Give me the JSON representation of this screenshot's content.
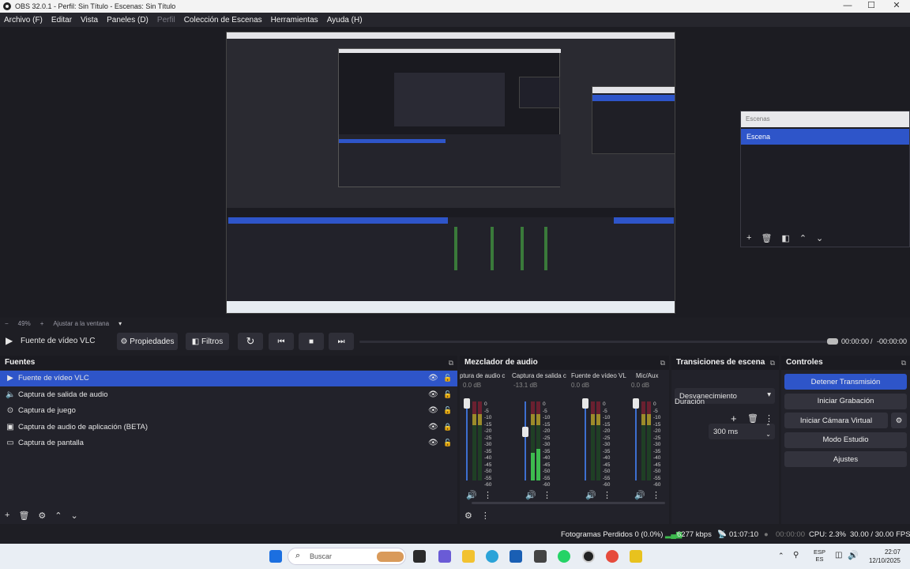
{
  "window": {
    "title": "OBS 32.0.1 - Perfil: Sin Título - Escenas: Sin Título",
    "minimize": "—",
    "maximize": "☐",
    "close": "✕"
  },
  "menu": [
    "Archivo (F)",
    "Editar",
    "Vista",
    "Paneles (D)",
    "Perfil",
    "Colección de Escenas",
    "Herramientas",
    "Ayuda (H)"
  ],
  "scenes_panel": {
    "header": "Escenas",
    "items": [
      "Escena"
    ]
  },
  "zoom": {
    "minus": "−",
    "level": "49%",
    "plus": "+",
    "fit": "Ajustar a la ventana"
  },
  "player": {
    "source": "Fuente de vídeo VLC",
    "properties": "Propiedades",
    "filters": "Filtros",
    "time": "00:00:00",
    "duration": "-00:00:00",
    "separator": "/"
  },
  "sources": {
    "title": "Fuentes",
    "items": [
      {
        "label": "Fuente de vídeo VLC",
        "icon": "play-icon"
      },
      {
        "label": "Captura de salida de audio",
        "icon": "speaker-icon"
      },
      {
        "label": "Captura de juego",
        "icon": "gamepad-icon"
      },
      {
        "label": "Captura de audio de aplicación (BETA)",
        "icon": "app-audio-icon"
      },
      {
        "label": "Captura de pantalla",
        "icon": "monitor-icon"
      }
    ]
  },
  "mixer": {
    "title": "Mezclador de audio",
    "ticks": [
      "0",
      "-5",
      "-10",
      "-15",
      "-20",
      "-25",
      "-30",
      "-35",
      "-40",
      "-45",
      "-50",
      "-55",
      "-60"
    ],
    "channels": [
      {
        "name": "ptura de audio c",
        "db": "0.0 dB",
        "level": 0.0
      },
      {
        "name": "Captura de salida c",
        "db": "-13.1 dB",
        "level": 0.35
      },
      {
        "name": "Fuente de vídeo VL",
        "db": "0.0 dB",
        "level": 0.0
      },
      {
        "name": "Mic/Aux",
        "db": "0.0 dB",
        "level": 0.0
      }
    ]
  },
  "transitions": {
    "title": "Transiciones de escena",
    "selected": "Desvanecimiento",
    "duration_label": "Duración",
    "duration": "300 ms"
  },
  "controls": {
    "title": "Controles",
    "stop_stream": "Detener Transmisión",
    "start_record": "Iniciar Grabación",
    "start_vcam": "Iniciar Cámara Virtual",
    "studio": "Modo Estudio",
    "settings": "Ajustes"
  },
  "status": {
    "dropped": "Fotogramas Perdidos 0 (0.0%)",
    "bitrate": "6277 kbps",
    "stream_time": "01:07:10",
    "rec_time": "00:00:00",
    "cpu": "CPU: 2.3%",
    "fps": "30.00 / 30.00 FPS"
  },
  "taskbar": {
    "search": "Buscar",
    "lang": "ESP",
    "lang2": "ES",
    "time": "22:07",
    "date": "12/10/2025"
  },
  "colors": {
    "accent": "#2e55c9",
    "bg": "#1e1e24",
    "dock": "#22222a"
  }
}
